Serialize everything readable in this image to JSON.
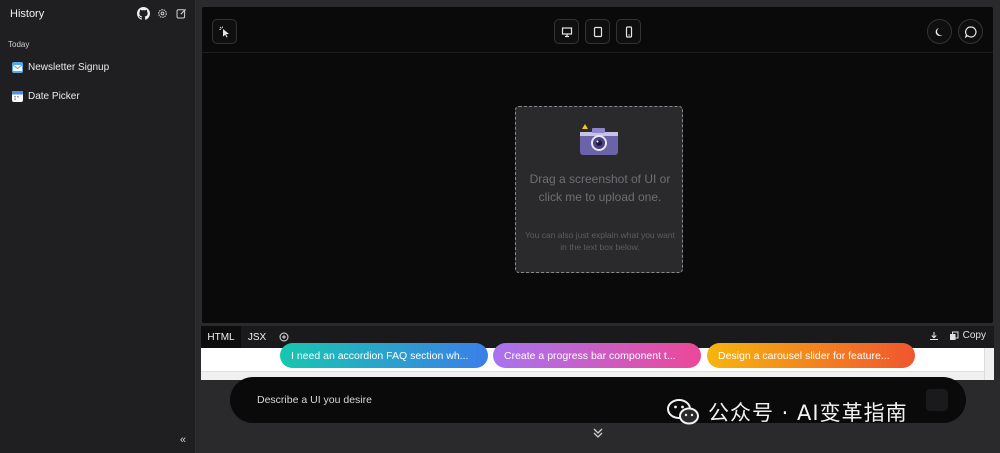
{
  "sidebar": {
    "title": "History",
    "section_label": "Today",
    "items": [
      {
        "label": "Newsletter Signup",
        "icon": "newsletter-icon"
      },
      {
        "label": "Date Picker",
        "icon": "calendar-icon"
      }
    ],
    "collapse_label": "«"
  },
  "toolbar": {
    "buttons": [
      "select-element-icon",
      "desktop-icon",
      "tablet-icon",
      "mobile-icon",
      "moon-icon",
      "chat-icon"
    ]
  },
  "dropzone": {
    "main_text": "Drag a screenshot of UI or click me to upload one.",
    "sub_text": "You can also just explain what you want in the text box below."
  },
  "code_tabs": {
    "tabs": [
      "HTML",
      "JSX"
    ],
    "active": "HTML",
    "copy_label": "Copy"
  },
  "suggestions": [
    {
      "label": "I need an accordion FAQ section wh...",
      "gradient": [
        "#18c6b0",
        "#3b7fe8"
      ]
    },
    {
      "label": "Create a progress bar component t...",
      "gradient": [
        "#a873f0",
        "#ec4899"
      ]
    },
    {
      "label": "Design a carousel slider for feature...",
      "gradient": [
        "#f6b40e",
        "#f0562e"
      ]
    }
  ],
  "prompt": {
    "placeholder": "Describe a UI you desire"
  },
  "watermark": {
    "text": "公众号 · AI变革指南"
  },
  "colors": {
    "sidebar_bg": "#1f1f21",
    "preview_bg": "#0a0a0b",
    "dropzone_bg": "#2a2a2c"
  }
}
